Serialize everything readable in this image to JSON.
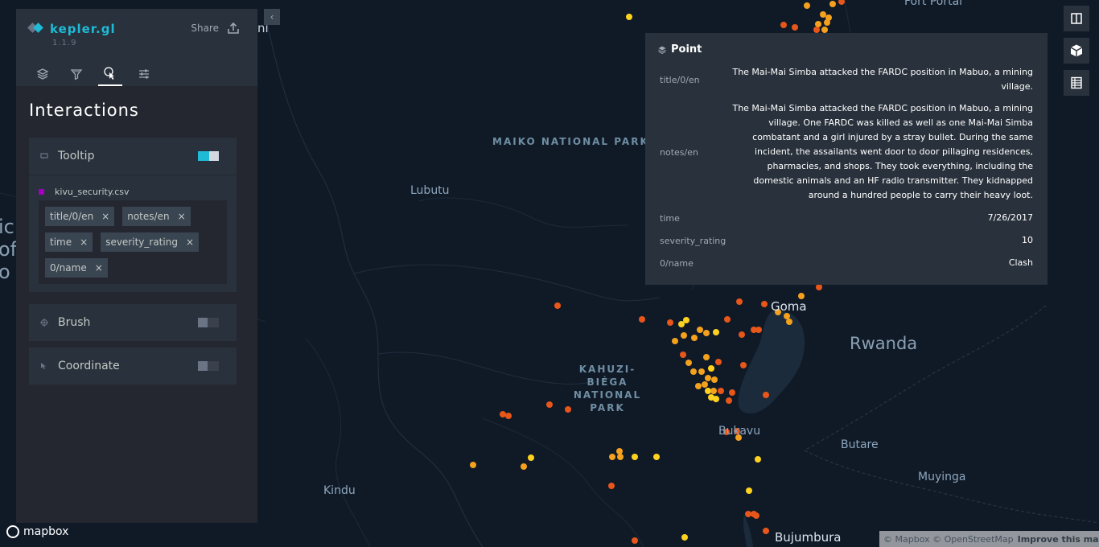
{
  "app": {
    "name": "kepler.gl",
    "version": "1.1.9",
    "share_label": "Share"
  },
  "panel": {
    "tabs": [
      "layers-icon",
      "filter-icon",
      "interactions-icon",
      "map-settings-icon"
    ],
    "active_tab": "interactions-icon",
    "section_title": "Interactions",
    "tooltip": {
      "label": "Tooltip",
      "enabled": true,
      "dataset": "kivu_security.csv",
      "dataset_color": "#a200c0",
      "fields": [
        "title/0/en",
        "notes/en",
        "time",
        "severity_rating",
        "0/name"
      ]
    },
    "brush": {
      "label": "Brush",
      "enabled": false
    },
    "coordinate": {
      "label": "Coordinate",
      "enabled": false
    }
  },
  "tooltip_popup": {
    "header": "Point",
    "rows": [
      {
        "key": "title/0/en",
        "value": "The Mai-Mai Simba attacked the FARDC position in Mabuo, a mining village."
      },
      {
        "key": "notes/en",
        "value": "The Mai-Mai Simba attacked the FARDC position in Mabuo, a mining village. One FARDC was killed as well as one Mai-Mai Simba combatant and a girl injured by a stray bullet. During the same incident, the assailants went door to door pillaging residences, pharmacies, and shops. They took everything, including the domestic animals and an HF radio transmitter. They kidnapped around a hundred people to carry their heavy loot."
      },
      {
        "key": "time",
        "value": "7/26/2017"
      },
      {
        "key": "severity_rating",
        "value": "10"
      },
      {
        "key": "0/name",
        "value": "Clash"
      }
    ]
  },
  "map_labels": {
    "maiko": "MAIKO NATIONAL PARK",
    "lubutu": "Lubutu",
    "kahuzi": "KAHUZI-BIÉGA NATIONAL PARK",
    "goma": "Goma",
    "rwanda": "Rwanda",
    "bukavu": "Bukavu",
    "butare": "Butare",
    "muyinga": "Muyinga",
    "kindu": "Kindu",
    "bujumbura": "Bujumbura",
    "fort_portal": "Fort Portal",
    "edge_ni": "ni",
    "edge_ic": "ic",
    "edge_of": "of",
    "edge_o": "o"
  },
  "map_tools": [
    "split-map-icon",
    "3d-view-icon",
    "data-table-icon"
  ],
  "footer": {
    "mapbox_logo": "mapbox",
    "attribution": "© Mapbox © OpenStreetMap",
    "improve": "Improve this map"
  },
  "colors": {
    "accent": "#1fbad6",
    "point_yellow": "#ffd21f",
    "point_orange": "#f4a11d",
    "point_red": "#e8561a"
  }
}
